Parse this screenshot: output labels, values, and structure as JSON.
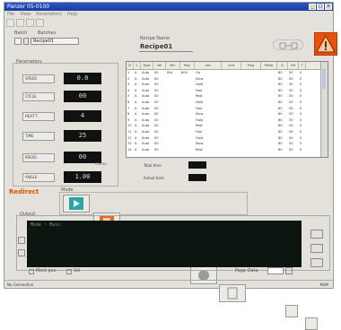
{
  "window": {
    "title": "Panzer 05-0100"
  },
  "menu": [
    "File",
    "View",
    "Parameters",
    "Help"
  ],
  "header": {
    "batch_label": "Batch",
    "batch_sub_label": "Batches",
    "batch_value": "Recipe01",
    "recipe_label": "Recipe Name",
    "recipe_name": "Recipe01"
  },
  "params": {
    "section_title": "Parameters",
    "caption": "Clamp",
    "rows": [
      {
        "label": "SPEED",
        "value": "0.0"
      },
      {
        "label": "CYCLE",
        "value": "00"
      },
      {
        "label": "HEAT T",
        "value": "4"
      },
      {
        "label": "TIME",
        "value": "25"
      },
      {
        "label": "PRESS",
        "value": "00"
      },
      {
        "label": "ANGLE",
        "value": "1.00"
      }
    ]
  },
  "table": {
    "headers": [
      "N",
      "L",
      "Type",
      "Val",
      "Min",
      "Max",
      "Set",
      "Unit",
      "Prog",
      "Mode",
      "%",
      "Hd",
      "T"
    ],
    "rows": [
      [
        "1",
        "A",
        "Auto",
        "00",
        "Std",
        "800",
        "Go",
        "",
        "",
        "",
        "80",
        "50",
        "0"
      ],
      [
        "2",
        "A",
        "Auto",
        "00",
        "",
        "",
        "Slow",
        "",
        "",
        "",
        "80",
        "50",
        "0"
      ],
      [
        "3",
        "A",
        "Auto",
        "00",
        "",
        "",
        "Hold",
        "",
        "",
        "",
        "80",
        "50",
        "0"
      ],
      [
        "4",
        "A",
        "Auto",
        "00",
        "",
        "",
        "Fast",
        "",
        "",
        "",
        "80",
        "50",
        "0"
      ],
      [
        "5",
        "A",
        "Auto",
        "00",
        "",
        "",
        "Rest",
        "",
        "",
        "",
        "80",
        "50",
        "0"
      ],
      [
        "6",
        "A",
        "Auto",
        "00",
        "",
        "",
        "Hold",
        "",
        "",
        "",
        "80",
        "50",
        "0"
      ],
      [
        "7",
        "A",
        "Auto",
        "00",
        "",
        "",
        "Fast",
        "",
        "",
        "",
        "80",
        "50",
        "0"
      ],
      [
        "8",
        "A",
        "Auto",
        "00",
        "",
        "",
        "Slow",
        "",
        "",
        "",
        "80",
        "50",
        "0"
      ],
      [
        "9",
        "A",
        "Auto",
        "00",
        "",
        "",
        "Hold",
        "",
        "",
        "",
        "80",
        "50",
        "0"
      ],
      [
        "10",
        "A",
        "Auto",
        "00",
        "",
        "",
        "Rest",
        "",
        "",
        "",
        "80",
        "50",
        "0"
      ],
      [
        "11",
        "A",
        "Auto",
        "00",
        "",
        "",
        "Fast",
        "",
        "",
        "",
        "80",
        "50",
        "0"
      ],
      [
        "12",
        "A",
        "Auto",
        "00",
        "",
        "",
        "Hold",
        "",
        "",
        "",
        "80",
        "50",
        "0"
      ],
      [
        "13",
        "A",
        "Auto",
        "00",
        "",
        "",
        "Slow",
        "",
        "",
        "",
        "80",
        "50",
        "0"
      ],
      [
        "14",
        "A",
        "Auto",
        "00",
        "",
        "",
        "Rest",
        "",
        "",
        "",
        "80",
        "50",
        "0"
      ]
    ]
  },
  "stats": {
    "total_label": "Total time",
    "total_value": "",
    "actual_label": "Actual time",
    "actual_value": ""
  },
  "actions": {
    "redirect_label": "Redirect",
    "group_label": "Mode"
  },
  "console": {
    "section_label": "Output",
    "line1": "Mode : Main"
  },
  "bottom": {
    "check1": "Mold pos",
    "check2": "Vol",
    "page_label": "Page Data"
  },
  "statusbar": {
    "left": "No Connection",
    "right": "NUM"
  },
  "colors": {
    "title_bar": "#1a3aa0",
    "accent_orange": "#e05000",
    "play_teal": "#2aa6a6",
    "stop_orange": "#e46a1a",
    "pause_green": "#3aa04a"
  }
}
